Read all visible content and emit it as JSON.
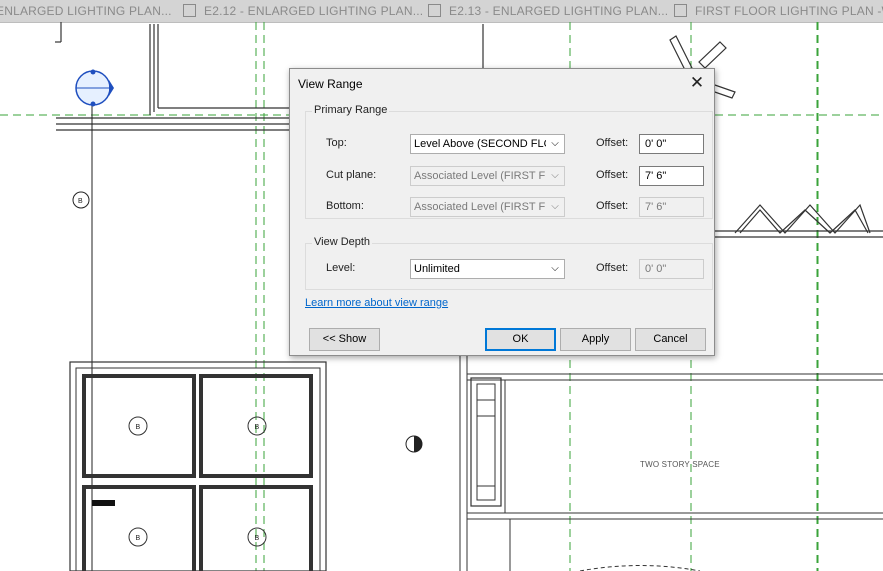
{
  "tabs": [
    {
      "label": "ENLARGED LIGHTING PLAN..."
    },
    {
      "label": "E2.12 - ENLARGED LIGHTING PLAN..."
    },
    {
      "label": "E2.13 - ENLARGED LIGHTING PLAN..."
    },
    {
      "label": "FIRST FLOOR LIGHTING PLAN -WES"
    }
  ],
  "drawing": {
    "space_label": "TWO STORY SPACE",
    "fixture_tag": "B"
  },
  "dialog": {
    "title": "View Range",
    "close_glyph": "✕",
    "primary_range": {
      "title": "Primary Range",
      "rows": [
        {
          "label": "Top:",
          "combo": "Level Above (SECOND FLOO",
          "offset_label": "Offset:",
          "offset": "0'  0\""
        },
        {
          "label": "Cut plane:",
          "combo": "Associated Level (FIRST FLO",
          "offset_label": "Offset:",
          "offset": "7'  6\""
        },
        {
          "label": "Bottom:",
          "combo": "Associated Level (FIRST FLO",
          "offset_label": "Offset:",
          "offset": "7'  6\""
        }
      ]
    },
    "view_depth": {
      "title": "View Depth",
      "label": "Level:",
      "combo": "Unlimited",
      "offset_label": "Offset:",
      "offset": "0'  0\""
    },
    "link": "Learn more about view range",
    "buttons": {
      "show": "<< Show",
      "ok": "OK",
      "apply": "Apply",
      "cancel": "Cancel"
    }
  }
}
